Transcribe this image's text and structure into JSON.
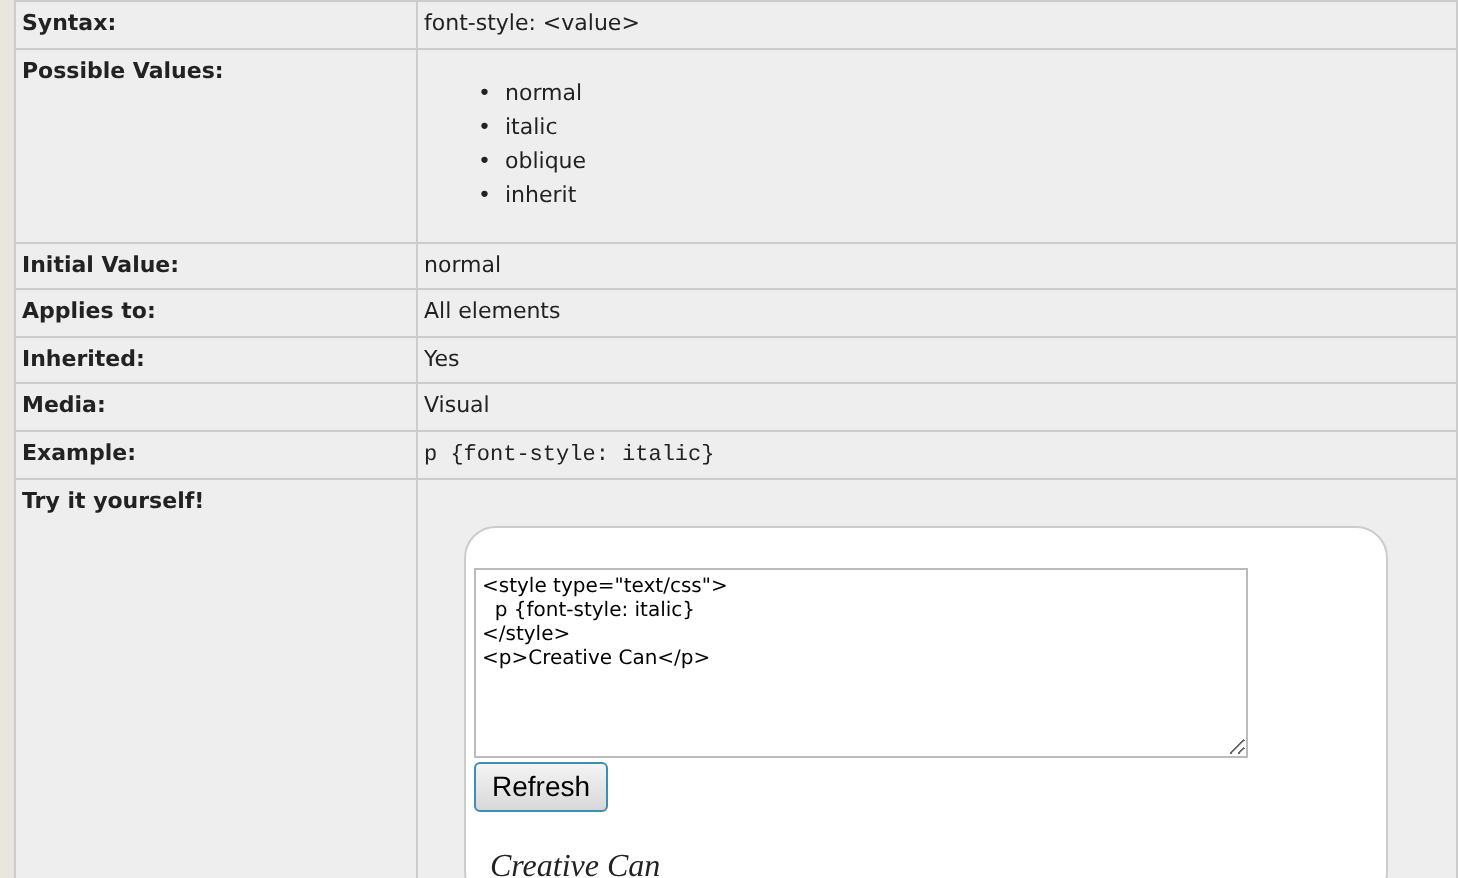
{
  "properties": [
    {
      "kind": "text",
      "label": "Syntax:",
      "value": "font-style: <value>"
    },
    {
      "kind": "list",
      "label": "Possible Values:",
      "bullet": "•",
      "items": [
        "normal",
        "italic",
        "oblique",
        "inherit"
      ]
    },
    {
      "kind": "text",
      "label": "Initial Value:",
      "value": "normal"
    },
    {
      "kind": "text",
      "label": "Applies to:",
      "value": "All elements"
    },
    {
      "kind": "text",
      "label": "Inherited:",
      "value": "Yes"
    },
    {
      "kind": "text",
      "label": "Media:",
      "value": "Visual"
    },
    {
      "kind": "code",
      "label": "Example:",
      "value": "p {font-style: italic}"
    },
    {
      "kind": "tryit",
      "label": "Try it yourself!",
      "code": "<style type=\"text/css\">\n  p {font-style: italic}\n</style>\n<p>Creative Can</p>",
      "button": "Refresh",
      "output": "Creative Can"
    }
  ]
}
